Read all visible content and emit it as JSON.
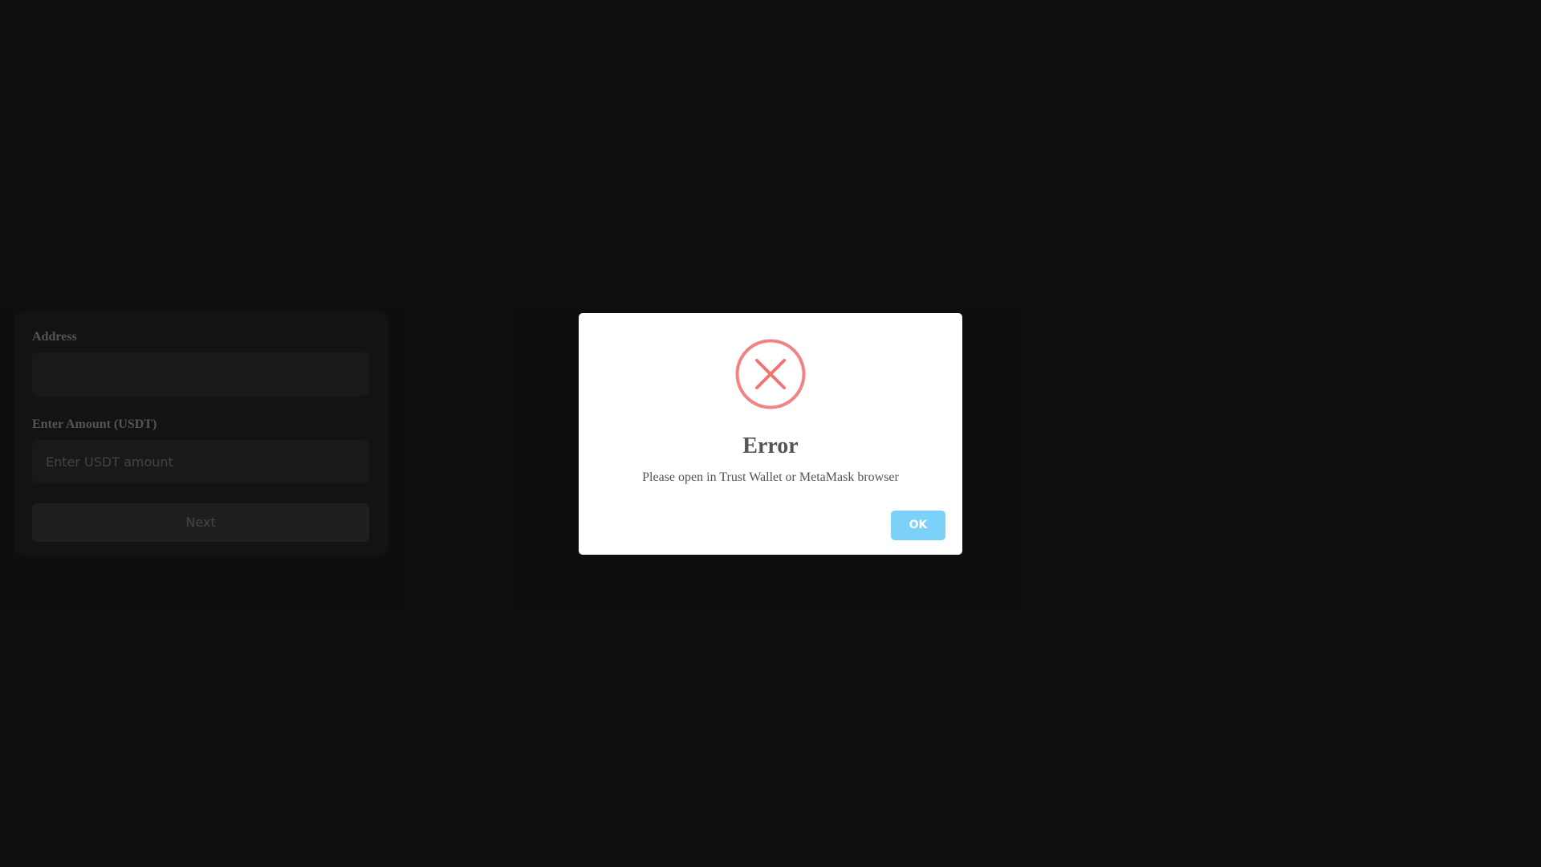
{
  "form": {
    "address_label": "Address",
    "address_value": "",
    "amount_label": "Enter Amount (USDT)",
    "amount_placeholder": "Enter USDT amount",
    "next_label": "Next"
  },
  "modal": {
    "icon": "error-x-circle-icon",
    "title": "Error",
    "message": "Please open in Trust Wallet or MetaMask browser",
    "ok_label": "OK"
  },
  "colors": {
    "page_background": "#111111",
    "error_icon": "#f27474",
    "ok_button": "#7cd1f9",
    "modal_text": "#545454"
  }
}
